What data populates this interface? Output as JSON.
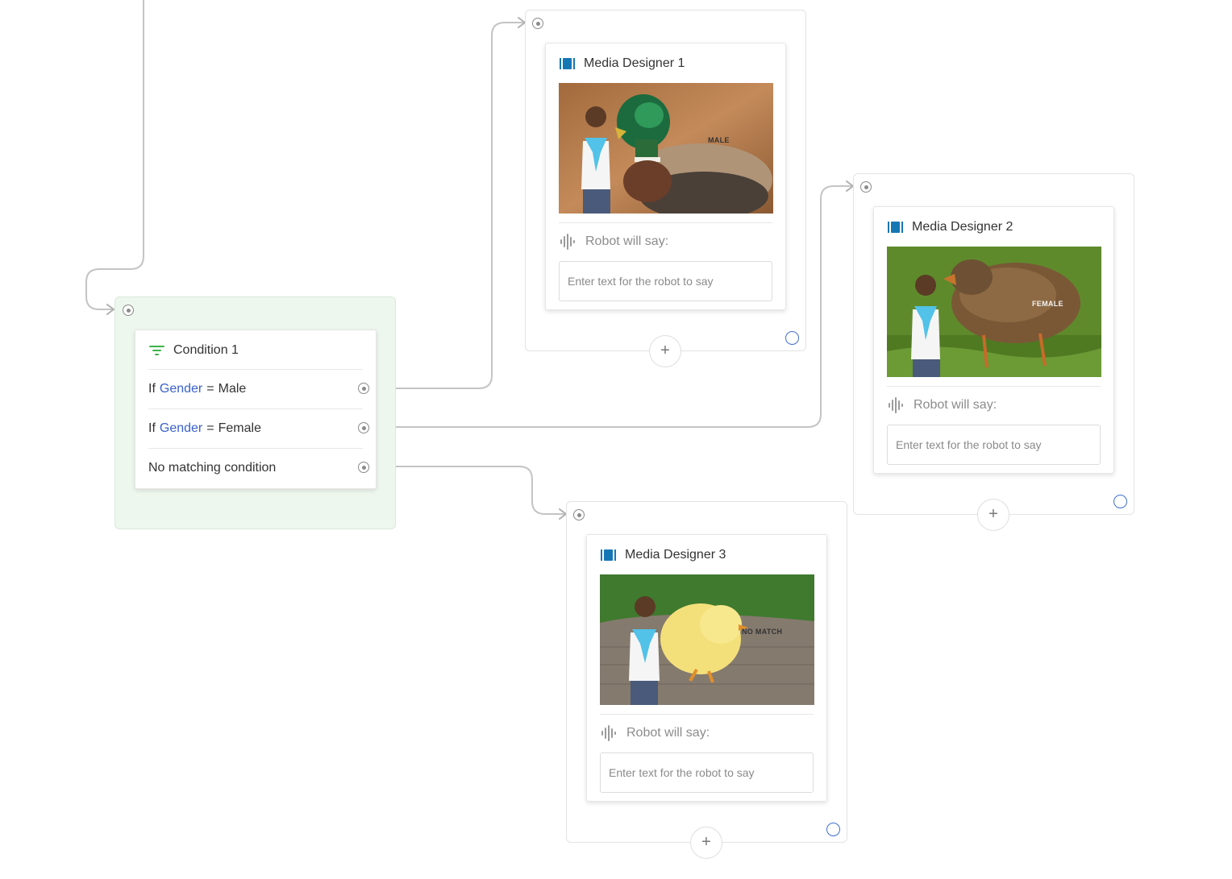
{
  "colors": {
    "accent_blue": "#3a62c9",
    "media_icon": "#1677b5",
    "condition_icon": "#3bb34a",
    "condition_bg": "#eef7ee",
    "edge": "#c4c4c4"
  },
  "condition": {
    "title": "Condition 1",
    "icon": "filter-icon",
    "rows": [
      {
        "prefix": "If",
        "variable": "Gender",
        "operator": "=",
        "value": "Male"
      },
      {
        "prefix": "If",
        "variable": "Gender",
        "operator": "=",
        "value": "Female"
      },
      {
        "text": "No matching condition"
      }
    ]
  },
  "media_nodes": [
    {
      "title": "Media Designer 1",
      "image_label": "MALE",
      "robot_label": "Robot will say:",
      "placeholder": "Enter text for the robot to say",
      "add_label": "+"
    },
    {
      "title": "Media Designer 2",
      "image_label": "FEMALE",
      "robot_label": "Robot will say:",
      "placeholder": "Enter text for the robot to say",
      "add_label": "+"
    },
    {
      "title": "Media Designer 3",
      "image_label": "NO MATCH",
      "robot_label": "Robot will say:",
      "placeholder": "Enter text for the robot to say",
      "add_label": "+"
    }
  ]
}
